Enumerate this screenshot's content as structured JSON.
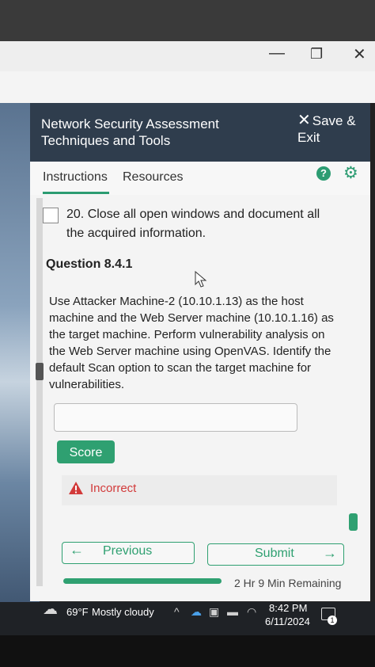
{
  "window": {
    "minimize_glyph": "—",
    "restore_glyph": "❐",
    "close_glyph": "✕"
  },
  "header": {
    "title": "Network Security Assessment Techniques and Tools",
    "save_exit": "Save & Exit",
    "save_exit_icon": "close-x-icon"
  },
  "tabs": [
    {
      "label": "Instructions",
      "active": true
    },
    {
      "label": "Resources",
      "active": false
    }
  ],
  "icons": {
    "help": "?",
    "settings": "gear-icon"
  },
  "step": {
    "text": "20. Close all open windows and document all the acquired information.",
    "checked": false
  },
  "question": {
    "title": "Question 8.4.1",
    "body": "Use Attacker Machine-2 (10.10.1.13) as the host machine and the Web Server machine (10.10.1.16) as the target machine. Perform vulnerability analysis on the Web Server machine using OpenVAS. Identify the default Scan option to scan the target machine for vulnerabilities.",
    "answer_value": ""
  },
  "score_button": "Score",
  "result": {
    "text": "Incorrect",
    "color": "#d23a3a"
  },
  "nav": {
    "previous": "Previous",
    "submit": "Submit"
  },
  "timer": {
    "remaining": "2 Hr 9 Min Remaining"
  },
  "taskbar": {
    "weather": "69°F",
    "weather_desc": "Mostly cloudy",
    "time": "8:42 PM",
    "date": "6/11/2024",
    "notification_count": "1"
  },
  "colors": {
    "accent": "#2fa071",
    "header_bg": "#2f3d4d",
    "error": "#d23a3a"
  }
}
